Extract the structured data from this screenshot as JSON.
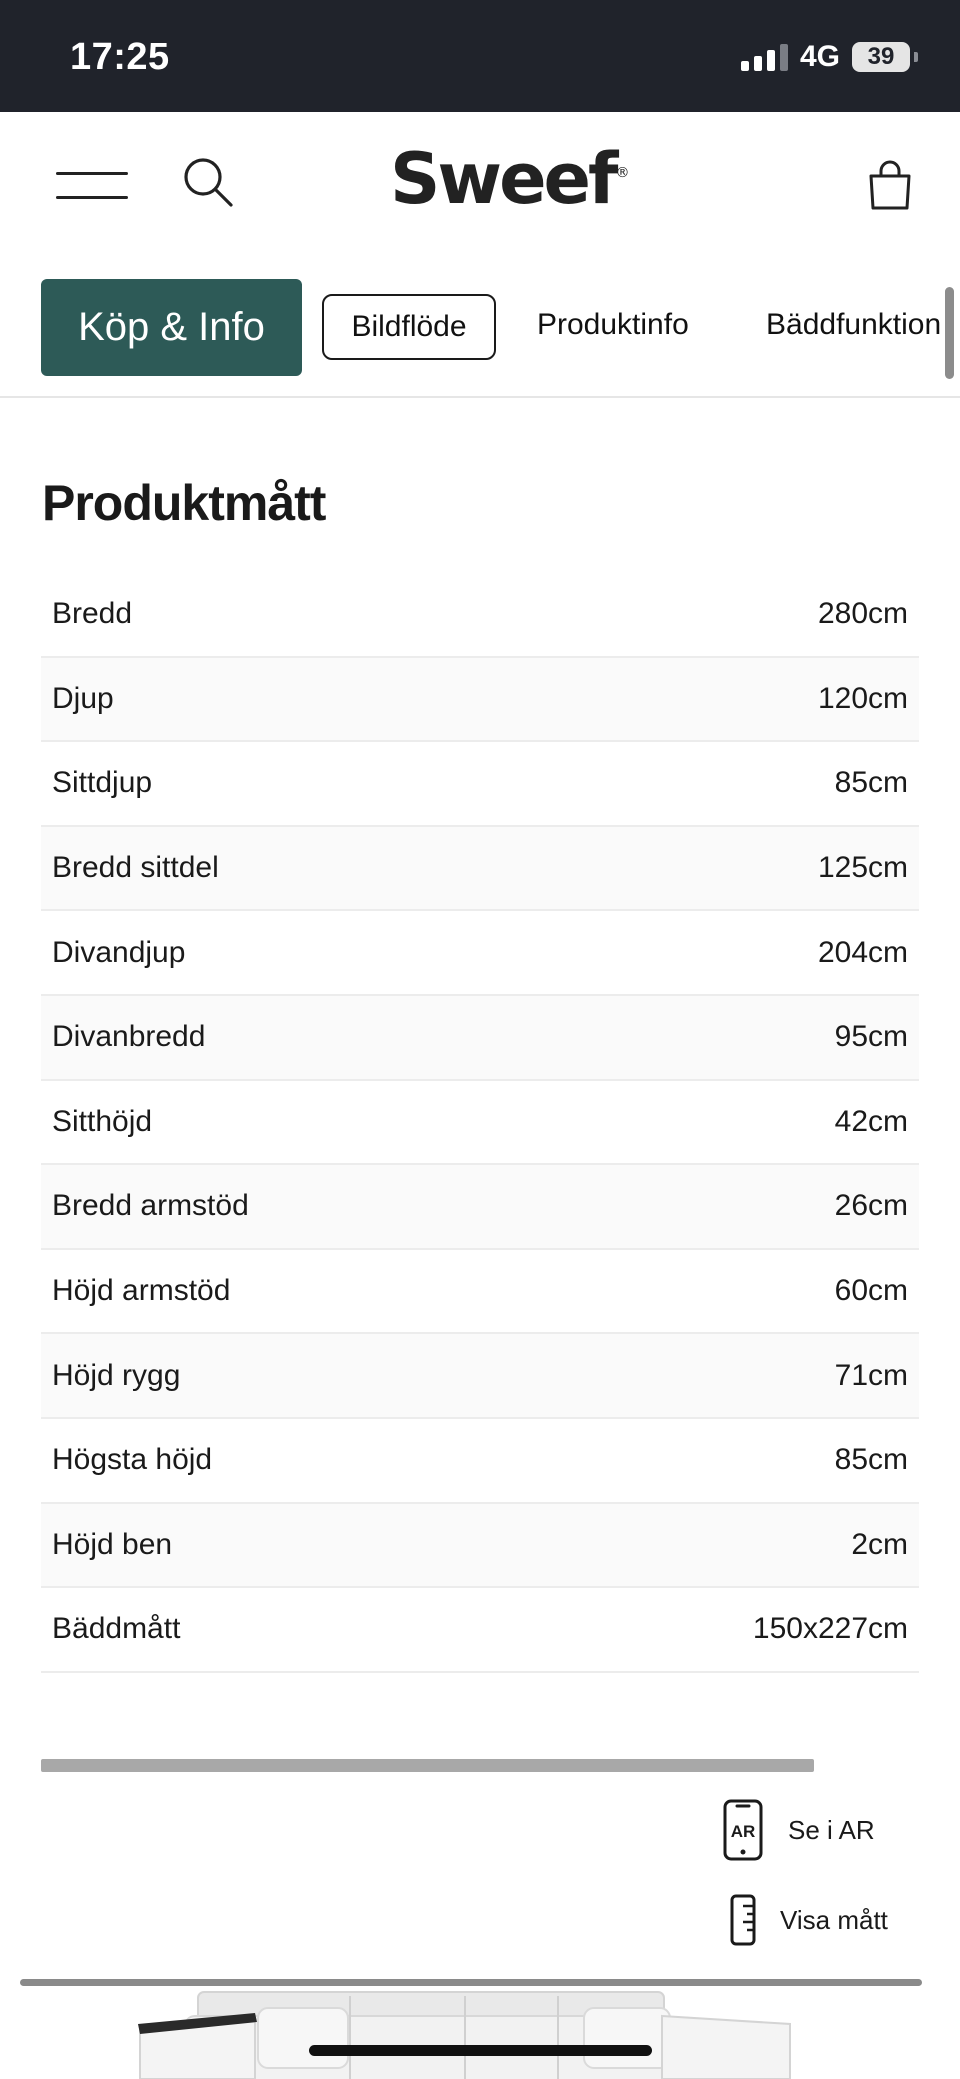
{
  "status_bar": {
    "time": "17:25",
    "network": "4G",
    "battery": "39"
  },
  "header": {
    "logo": "Sweef",
    "logo_mark": "®",
    "icons": [
      "hamburger-menu-icon",
      "search-icon",
      "shopping-bag-icon"
    ]
  },
  "tabs": [
    {
      "label": "Köp & Info",
      "state": "active"
    },
    {
      "label": "Bildflöde",
      "state": "outlined"
    },
    {
      "label": "Produktinfo",
      "state": "default"
    },
    {
      "label": "Bäddfunktion",
      "state": "default"
    }
  ],
  "section": {
    "title": "Produktmått"
  },
  "specs": [
    {
      "label": "Bredd",
      "value": "280cm"
    },
    {
      "label": "Djup",
      "value": "120cm"
    },
    {
      "label": "Sittdjup",
      "value": "85cm"
    },
    {
      "label": "Bredd sittdel",
      "value": "125cm"
    },
    {
      "label": "Divandjup",
      "value": "204cm"
    },
    {
      "label": "Divanbredd",
      "value": "95cm"
    },
    {
      "label": "Sitthöjd",
      "value": "42cm"
    },
    {
      "label": "Bredd armstöd",
      "value": "26cm"
    },
    {
      "label": "Höjd armstöd",
      "value": "60cm"
    },
    {
      "label": "Höjd rygg",
      "value": "71cm"
    },
    {
      "label": "Högsta höjd",
      "value": "85cm"
    },
    {
      "label": "Höjd ben",
      "value": "2cm"
    },
    {
      "label": "Bäddmått",
      "value": "150x227cm"
    }
  ],
  "actions": {
    "ar_label": "Se i AR",
    "ar_icon_text": "AR",
    "measure_label": "Visa mått"
  },
  "colors": {
    "status_bar_bg": "#20232b",
    "accent": "#2d5a57",
    "row_alt": "#fafafa"
  }
}
